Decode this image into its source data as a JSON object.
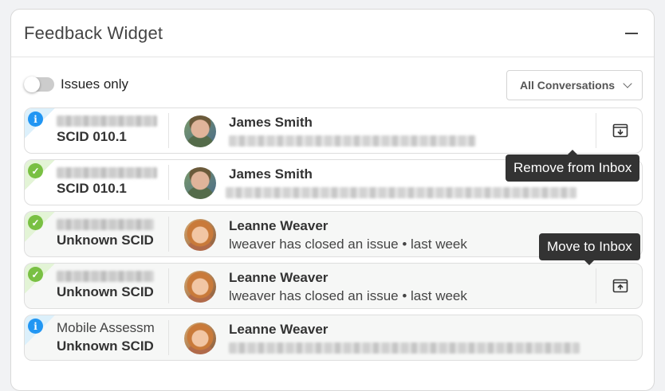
{
  "widget": {
    "title": "Feedback Widget"
  },
  "toolbar": {
    "toggle_label": "Issues only",
    "filter_value": "All Conversations"
  },
  "rows": [
    {
      "status": "info",
      "scid": "SCID 010.1",
      "user": "James Smith",
      "avatar": "man",
      "background": "white"
    },
    {
      "status": "ok",
      "scid": "SCID 010.1",
      "user": "James Smith",
      "avatar": "man",
      "background": "white"
    },
    {
      "status": "ok",
      "scid": "Unknown SCID",
      "user": "Leanne Weaver",
      "message": "lweaver has closed an issue • last week",
      "avatar": "woman",
      "background": "grey"
    },
    {
      "status": "ok",
      "scid": "Unknown SCID",
      "user": "Leanne Weaver",
      "message": "lweaver has closed an issue • last week",
      "avatar": "woman",
      "background": "grey"
    },
    {
      "status": "info",
      "name": "Mobile Assessm",
      "scid": "Unknown SCID",
      "user": "Leanne Weaver",
      "avatar": "woman",
      "background": "grey"
    }
  ],
  "tooltips": {
    "remove": "Remove from Inbox",
    "move": "Move to Inbox"
  },
  "colors": {
    "info": "#2196f3",
    "ok": "#79c043",
    "tooltip": "#333333"
  }
}
